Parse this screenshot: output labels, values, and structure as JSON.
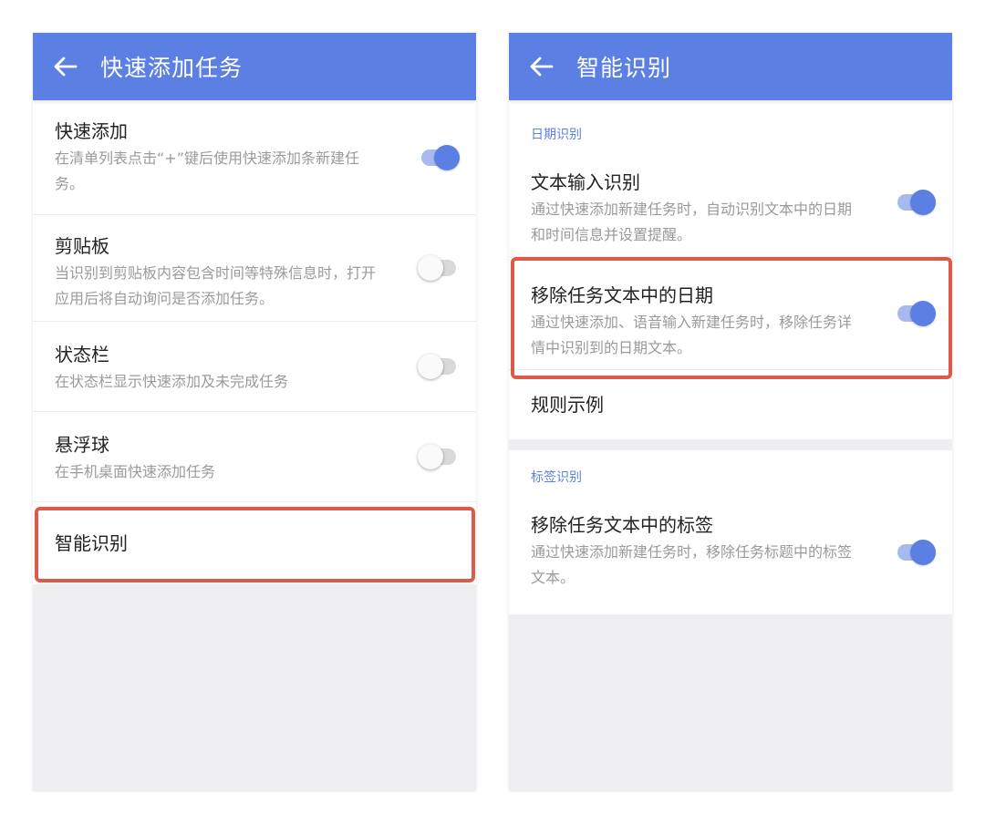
{
  "left": {
    "title": "快速添加任务",
    "items": [
      {
        "title": "快速添加",
        "desc": "在清单列表点击“+”键后使用快速添加条新建任务。",
        "toggle": "on"
      },
      {
        "title": "剪贴板",
        "desc": "当识别到剪贴板内容包含时间等特殊信息时，打开应用后将自动询问是否添加任务。",
        "toggle": "off"
      },
      {
        "title": "状态栏",
        "desc": "在状态栏显示快速添加及未完成任务",
        "toggle": "off"
      },
      {
        "title": "悬浮球",
        "desc": "在手机桌面快速添加任务",
        "toggle": "off"
      },
      {
        "title": "智能识别"
      }
    ]
  },
  "right": {
    "title": "智能识别",
    "sections": [
      {
        "header": "日期识别",
        "items": [
          {
            "title": "文本输入识别",
            "desc": "通过快速添加新建任务时，自动识别文本中的日期和时间信息并设置提醒。",
            "toggle": "on"
          },
          {
            "title": "移除任务文本中的日期",
            "desc": "通过快速添加、语音输入新建任务时，移除任务详情中识别到的日期文本。",
            "toggle": "on"
          },
          {
            "title": "规则示例"
          }
        ]
      },
      {
        "header": "标签识别",
        "items": [
          {
            "title": "移除任务文本中的标签",
            "desc": "通过快速添加新建任务时，移除任务标题中的标签文本。",
            "toggle": "on"
          }
        ]
      }
    ]
  },
  "colors": {
    "accent": "#5b7fe3",
    "highlight": "#dd5a48",
    "background": "#efeff2"
  },
  "icons": {
    "back": "arrow-left-icon"
  }
}
